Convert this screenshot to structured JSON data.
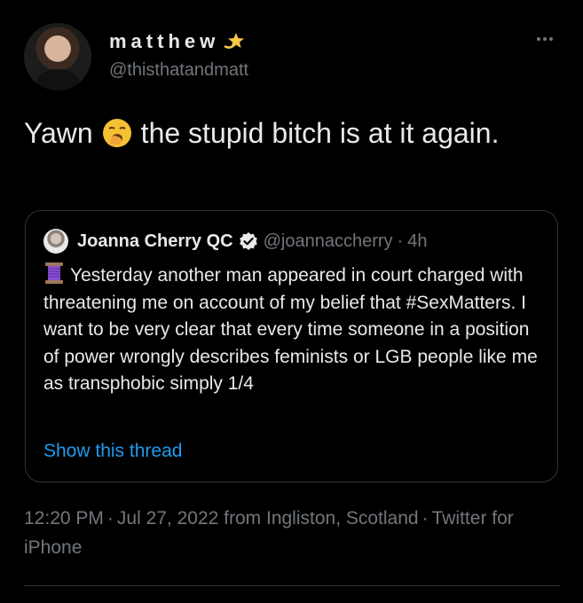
{
  "author": {
    "display_name": "matthew",
    "name_emoji": "shooting-star-icon",
    "handle": "@thisthatandmatt",
    "avatar": "profile-photo"
  },
  "more_icon": "more-horizontal-icon",
  "tweet": {
    "text_before": "Yawn",
    "emoji": "yawning-face-icon",
    "text_after": "the stupid bitch is at it again."
  },
  "quote": {
    "display_name": "Joanna Cherry QC",
    "verified_icon": "verified-badge-icon",
    "handle": "@joannaccherry",
    "separator": "·",
    "time": "4h",
    "lead_emoji": "thread-spool-icon",
    "text": "Yesterday another man appeared in court charged with threatening me on account of my belief that #SexMatters. I want to be very clear that every time someone in a position of power wrongly describes feminists or LGB people like me as transphobic simply 1/4",
    "show_thread": "Show this thread"
  },
  "meta": {
    "time": "12:20 PM",
    "separator": "·",
    "date_location": "Jul 27, 2022 from Ingliston, Scotland",
    "source": "Twitter for iPhone"
  },
  "colors": {
    "background": "#000000",
    "text": "#e7e9ea",
    "secondary": "#71767b",
    "link": "#1d9bf0",
    "border": "#2f3336"
  }
}
